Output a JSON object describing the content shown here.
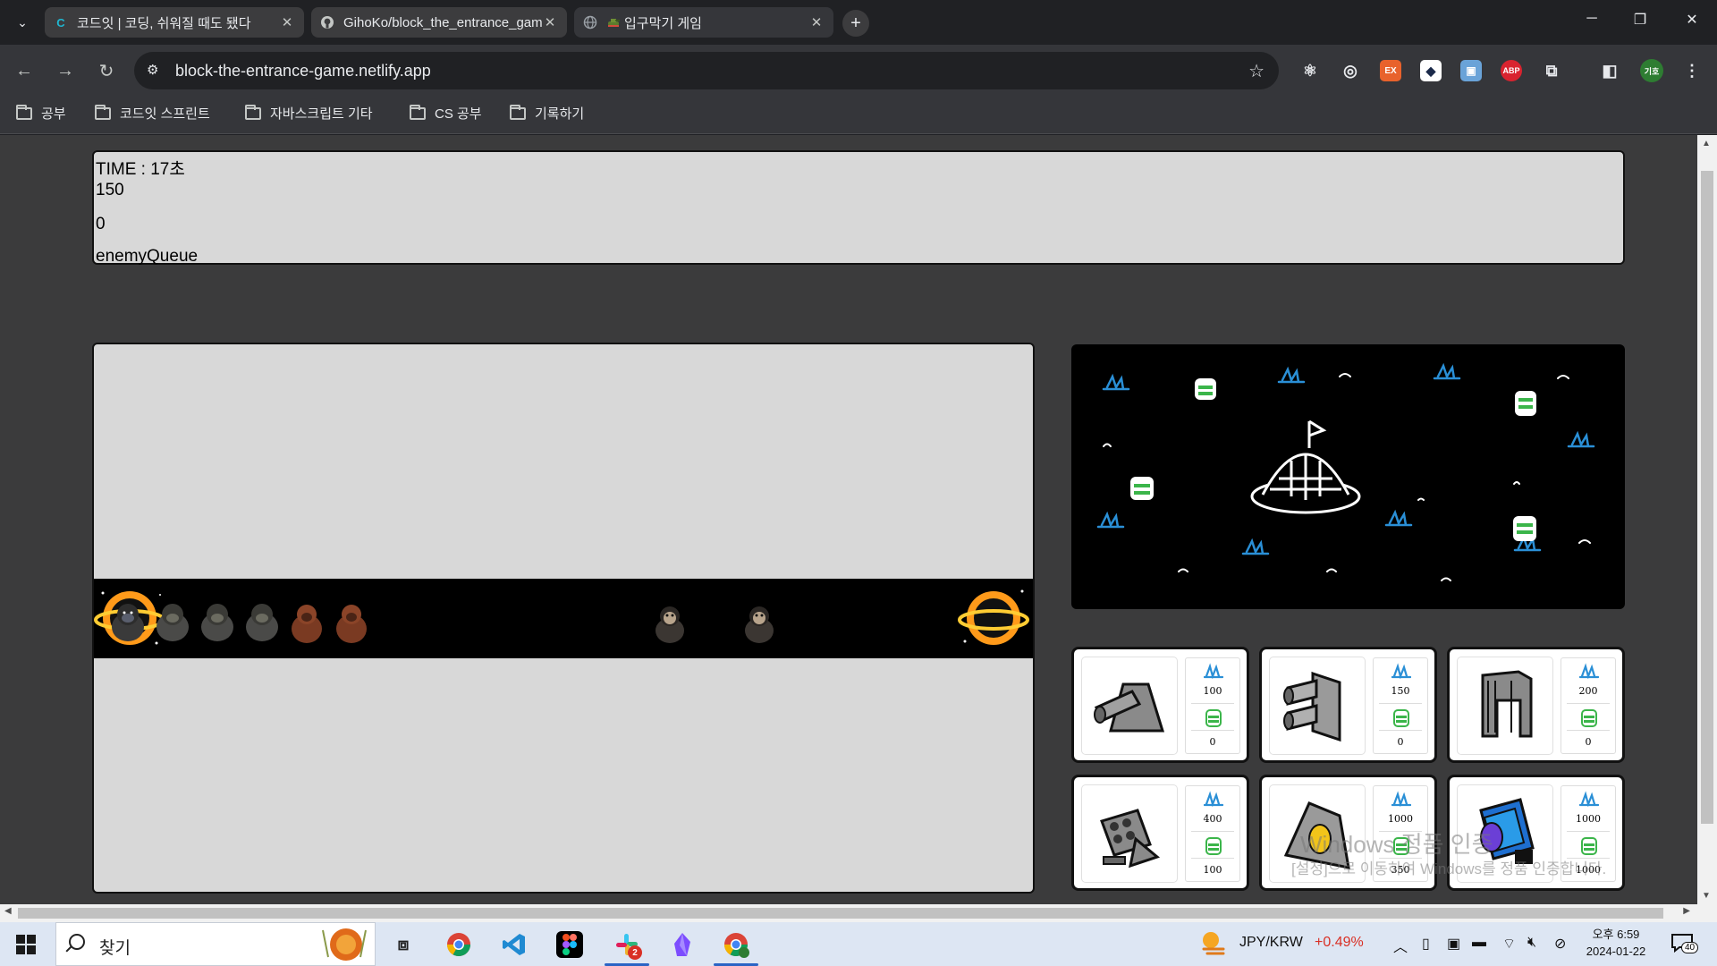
{
  "tabs": [
    {
      "title": "코드잇 | 코딩, 쉬워질 때도 됐다",
      "favicon": "codeit-logo-icon"
    },
    {
      "title": "GihoKo/block_the_entrance_game",
      "favicon": "github-icon"
    },
    {
      "title": "입구막기 게임",
      "favicon": "globe-icon"
    }
  ],
  "toolbar": {
    "url": "block-the-entrance-game.netlify.app",
    "extensions": [
      "react-icon",
      "target-icon",
      "EX",
      "shield-icon",
      "puzzle-icon",
      "ABP",
      "extensions-icon"
    ],
    "profile": "기호"
  },
  "bookmarks": [
    "공부",
    "코드잇 스프린트",
    "자바스크립트 기타",
    "CS 공부",
    "기록하기"
  ],
  "game": {
    "time_label": "TIME : 17초",
    "gold": "150",
    "score": "0",
    "queue_label": "enemyQueue"
  },
  "towers": [
    {
      "name": "cannon-tower",
      "gem_cost": "100",
      "stone_cost": "0"
    },
    {
      "name": "double-cannon-tower",
      "gem_cost": "150",
      "stone_cost": "0"
    },
    {
      "name": "pillar-tower",
      "gem_cost": "200",
      "stone_cost": "0"
    },
    {
      "name": "multi-barrel-tower",
      "gem_cost": "400",
      "stone_cost": "100"
    },
    {
      "name": "gold-lens-tower",
      "gem_cost": "1000",
      "stone_cost": "350"
    },
    {
      "name": "blue-laser-tower",
      "gem_cost": "1000",
      "stone_cost": "1000"
    }
  ],
  "watermark": {
    "line1": "Windows 정품 인증",
    "line2": "[설정]으로 이동하여 Windows를 정품 인증합니다."
  },
  "taskbar": {
    "search": "찾기",
    "ticker_pair": "JPY/KRW",
    "ticker_change": "+0.49%",
    "time": "오후 6:59",
    "date": "2024-01-22",
    "notifications": "40",
    "slack_badge": "2"
  },
  "colors": {
    "page_bg": "#3b3b3c",
    "panel_bg": "#d8d8d8",
    "lane_bg": "#000000",
    "gem_blue": "#2a8fd6",
    "stone_green": "#3bb54a",
    "ticker_red": "#d93025"
  }
}
